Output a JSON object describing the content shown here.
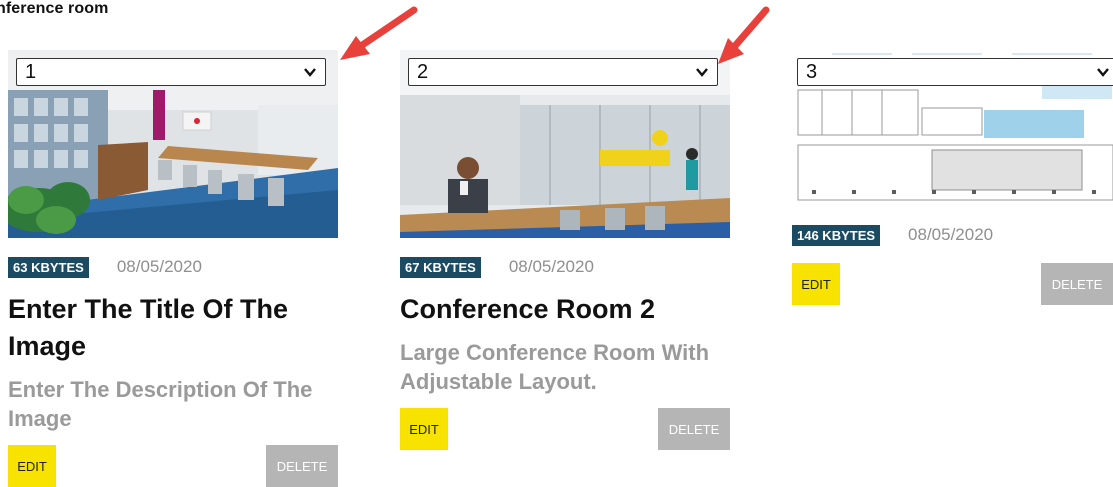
{
  "section": {
    "title": "nference room"
  },
  "cards": [
    {
      "order": "1",
      "size": "63 KBYTES",
      "date": "08/05/2020",
      "title": "Enter The Title Of The Image",
      "description": "Enter The Description Of The Image",
      "edit_label": "EDIT",
      "delete_label": "DELETE",
      "image": "conference-room-blue-carpet"
    },
    {
      "order": "2",
      "size": "67 KBYTES",
      "date": "08/05/2020",
      "title": "Conference Room 2",
      "description": "Large Conference Room With Adjustable Layout.",
      "edit_label": "EDIT",
      "delete_label": "DELETE",
      "image": "conference-room-man-at-table"
    },
    {
      "order": "3",
      "size": "146 KBYTES",
      "date": "08/05/2020",
      "title": "",
      "description": "",
      "edit_label": "EDIT",
      "delete_label": "DELETE",
      "image": "floor-plan"
    }
  ],
  "colors": {
    "badge": "#1b4b63",
    "edit": "#f7e200",
    "delete": "#b5b5b5",
    "arrow": "#e8413b"
  },
  "icons": {
    "select": "chevron-down-icon",
    "annotation": "red-arrow-icon"
  }
}
